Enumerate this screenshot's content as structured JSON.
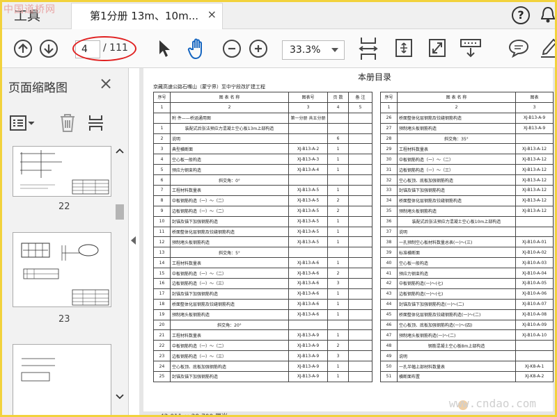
{
  "watermarks": {
    "top_left": "中国道桥网",
    "bottom_right": "www.cndao.com"
  },
  "tabs": {
    "tools": "工具",
    "document": "第1分册 13m、10m...",
    "close": "×"
  },
  "header": {
    "help": "?"
  },
  "toolbar": {
    "page_current": "4",
    "page_total": "/ 111",
    "zoom": "33.3%"
  },
  "sidebar": {
    "title": "页面缩略图",
    "close": "×",
    "thumbnail_labels": [
      "22",
      "23"
    ]
  },
  "document": {
    "title": "本册目录",
    "subtitle": "京藏高速公路石嘴山（蒙宁界）至中宁段改扩建工程",
    "left_table": {
      "headers": [
        "序号",
        "图  表  名  称",
        "图表号",
        "页 数",
        "备  注"
      ],
      "index_row": [
        "1",
        "2",
        "3",
        "4",
        "5"
      ],
      "rows": [
        [
          "",
          "附 件——桥涵通用图",
          "第一分册 共五分册",
          "",
          ""
        ],
        [
          "1",
          "装配式后张法预应力混凝土空心板13m上部构造",
          "",
          "",
          ""
        ],
        [
          "2",
          "说明",
          "",
          "6",
          ""
        ],
        [
          "3",
          "典型横断面",
          "XJ-B13-A-2",
          "1",
          ""
        ],
        [
          "4",
          "空心板一般构造",
          "XJ-B13-A-3",
          "1",
          ""
        ],
        [
          "5",
          "预应力钢束构造",
          "XJ-B13-A-4",
          "1",
          ""
        ],
        [
          "6",
          "斜交角：0°",
          "",
          "",
          ""
        ],
        [
          "7",
          "工程材料数量表",
          "XJ-B13-A-5",
          "1",
          ""
        ],
        [
          "8",
          "中板钢筋构造（一）～（二）",
          "XJ-B13-A-5",
          "2",
          ""
        ],
        [
          "9",
          "边板钢筋构造（一）～（二）",
          "XJ-B13-A-5",
          "2",
          ""
        ],
        [
          "10",
          "封锚及锚下加强钢筋构造",
          "XJ-B13-A-5",
          "1",
          ""
        ],
        [
          "11",
          "桥面整体化层钢筋及铰缝钢筋构造",
          "XJ-B13-A-5",
          "1",
          ""
        ],
        [
          "12",
          "预制堵头板钢筋构造",
          "XJ-B13-A-5",
          "1",
          ""
        ],
        [
          "13",
          "斜交角：5°",
          "",
          "",
          ""
        ],
        [
          "14",
          "工程材料数量表",
          "XJ-B13-A-6",
          "1",
          ""
        ],
        [
          "15",
          "中板钢筋构造（一）～（二）",
          "XJ-B13-A-6",
          "2",
          ""
        ],
        [
          "16",
          "边板钢筋构造（一）～（三）",
          "XJ-B13-A-6",
          "3",
          ""
        ],
        [
          "17",
          "封锚及锚下加强钢筋构造",
          "XJ-B13-A-6",
          "1",
          ""
        ],
        [
          "18",
          "桥面整体化层钢筋及铰缝钢筋构造",
          "XJ-B13-A-6",
          "1",
          ""
        ],
        [
          "19",
          "预制堵头板钢筋构造",
          "XJ-B13-A-6",
          "1",
          ""
        ],
        [
          "20",
          "斜交角：20°",
          "",
          "",
          ""
        ],
        [
          "21",
          "工程材料数量表",
          "XJ-B13-A-9",
          "1",
          ""
        ],
        [
          "22",
          "中板钢筋构造（一）～（二）",
          "XJ-B13-A-9",
          "2",
          ""
        ],
        [
          "23",
          "边板钢筋构造（一）～（三）",
          "XJ-B13-A-9",
          "3",
          ""
        ],
        [
          "24",
          "空心板顶、底板加强钢筋构造",
          "XJ-B13-A-9",
          "1",
          ""
        ],
        [
          "25",
          "封锚及锚下加强钢筋构造",
          "XJ-B13-A-9",
          "1",
          ""
        ]
      ]
    },
    "right_table": {
      "headers": [
        "序号",
        "图  表  名  称",
        "图表"
      ],
      "index_row": [
        "1",
        "2",
        "3"
      ],
      "rows": [
        [
          "26",
          "桥面整体化层钢筋及铰缝钢筋构造",
          "XJ-B13-A-9"
        ],
        [
          "27",
          "预制堵头板钢筋构造",
          "XJ-B13-A-9"
        ],
        [
          "28",
          "斜交角：35°",
          ""
        ],
        [
          "29",
          "工程材料数量表",
          "XJ-B13-A-12"
        ],
        [
          "30",
          "中板钢筋构造（一）～（二）",
          "XJ-B13-A-12"
        ],
        [
          "31",
          "边板钢筋构造（一）～（三）",
          "XJ-B13-A-12"
        ],
        [
          "32",
          "空心板顶、底板加强钢筋构造",
          "XJ-B13-A-12"
        ],
        [
          "33",
          "封锚及锚下加强钢筋构造",
          "XJ-B13-A-12"
        ],
        [
          "34",
          "桥面整体化层钢筋及铰缝钢筋构造",
          "XJ-B13-A-12"
        ],
        [
          "35",
          "预制堵头板钢筋构造",
          "XJ-B13-A-12"
        ],
        [
          "36",
          "装配式后张法预应力混凝土空心板10m上部构造",
          ""
        ],
        [
          "37",
          "说明",
          ""
        ],
        [
          "38",
          "一孔预制空心板材料数量总表(一)～(三)",
          "XJ-B10-A-01"
        ],
        [
          "39",
          "标准横断面",
          "XJ-B10-A-02"
        ],
        [
          "40",
          "空心板一般构造",
          "XJ-B10-A-03"
        ],
        [
          "41",
          "预应力钢束构造",
          "XJ-B10-A-04"
        ],
        [
          "42",
          "中板钢筋构造(一)～(七)",
          "XJ-B10-A-05"
        ],
        [
          "43",
          "边板钢筋构造(一)～(七)",
          "XJ-B10-A-06"
        ],
        [
          "44",
          "封锚及锚下加强钢筋构造(一)～(二)",
          "XJ-B10-A-07"
        ],
        [
          "45",
          "桥面整体化层钢筋及铰缝钢筋构造(一)～(二)",
          "XJ-B10-A-08"
        ],
        [
          "46",
          "空心板顶、底板加强钢筋构造(一)～(四)",
          "XJ-B10-A-09"
        ],
        [
          "47",
          "预制堵头板钢筋构造(一)～(二)",
          "XJ-B10-A-10"
        ],
        [
          "48",
          "钢筋混凝土空心板8m上部构造",
          ""
        ],
        [
          "49",
          "说明",
          ""
        ],
        [
          "50",
          "一孔半幅上部材料数量表",
          "XJ-K8-A-1"
        ],
        [
          "51",
          "横断面布置",
          "XJ-K8-A-2"
        ]
      ]
    }
  },
  "status": {
    "bottom": "42.011 × 29.700 厘米"
  },
  "colors": {
    "accent": "#1565c0",
    "ellipse": "#e02020",
    "frame": "#f2d23c"
  }
}
